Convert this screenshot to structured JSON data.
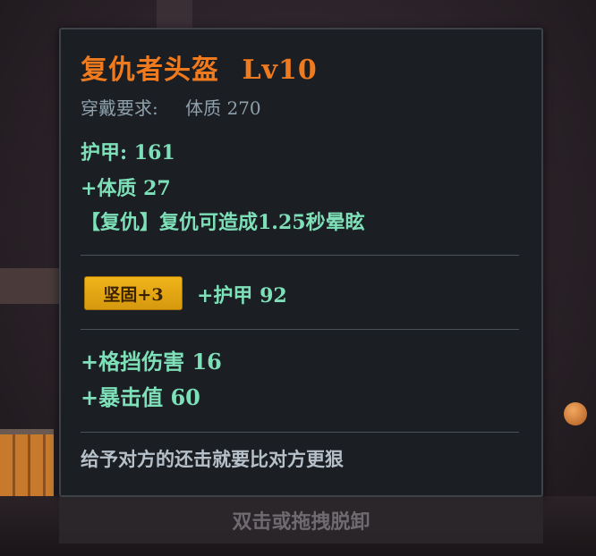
{
  "item": {
    "name": "复仇者头盔",
    "level": "Lv10",
    "requirement_label": "穿戴要求:",
    "requirement_value": "体质 270",
    "armor": "护甲:  161",
    "bonus_stat": "+体质 27",
    "effect": "【复仇】复仇可造成1.25秒晕眩",
    "gem_label": "坚固+3",
    "gem_bonus": "+护甲 92",
    "extra_stats": [
      "+格挡伤害 16",
      "+暴击值 60"
    ],
    "flavor_text": "给予对方的还击就要比对方更狠"
  },
  "hint": "双击或拖拽脱卸",
  "colors": {
    "title": "#f07a1e",
    "stat": "#7ee0b8",
    "requirement": "#8fa0ad",
    "gem_badge": "#f0b41a",
    "panel_bg": "#1b1f23"
  }
}
